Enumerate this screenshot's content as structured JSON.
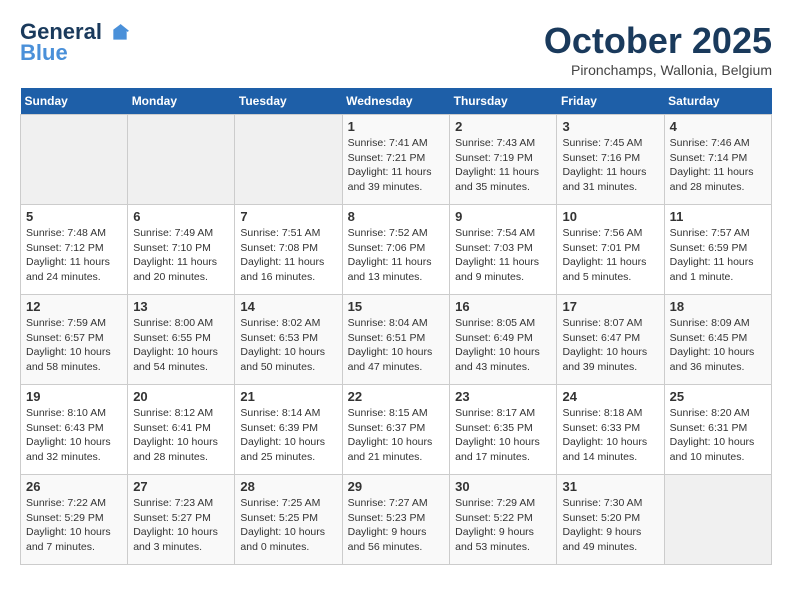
{
  "header": {
    "logo_line1": "General",
    "logo_line2": "Blue",
    "month": "October 2025",
    "location": "Pironchamps, Wallonia, Belgium"
  },
  "weekdays": [
    "Sunday",
    "Monday",
    "Tuesday",
    "Wednesday",
    "Thursday",
    "Friday",
    "Saturday"
  ],
  "weeks": [
    [
      {
        "day": "",
        "info": ""
      },
      {
        "day": "",
        "info": ""
      },
      {
        "day": "",
        "info": ""
      },
      {
        "day": "1",
        "info": "Sunrise: 7:41 AM\nSunset: 7:21 PM\nDaylight: 11 hours and 39 minutes."
      },
      {
        "day": "2",
        "info": "Sunrise: 7:43 AM\nSunset: 7:19 PM\nDaylight: 11 hours and 35 minutes."
      },
      {
        "day": "3",
        "info": "Sunrise: 7:45 AM\nSunset: 7:16 PM\nDaylight: 11 hours and 31 minutes."
      },
      {
        "day": "4",
        "info": "Sunrise: 7:46 AM\nSunset: 7:14 PM\nDaylight: 11 hours and 28 minutes."
      }
    ],
    [
      {
        "day": "5",
        "info": "Sunrise: 7:48 AM\nSunset: 7:12 PM\nDaylight: 11 hours and 24 minutes."
      },
      {
        "day": "6",
        "info": "Sunrise: 7:49 AM\nSunset: 7:10 PM\nDaylight: 11 hours and 20 minutes."
      },
      {
        "day": "7",
        "info": "Sunrise: 7:51 AM\nSunset: 7:08 PM\nDaylight: 11 hours and 16 minutes."
      },
      {
        "day": "8",
        "info": "Sunrise: 7:52 AM\nSunset: 7:06 PM\nDaylight: 11 hours and 13 minutes."
      },
      {
        "day": "9",
        "info": "Sunrise: 7:54 AM\nSunset: 7:03 PM\nDaylight: 11 hours and 9 minutes."
      },
      {
        "day": "10",
        "info": "Sunrise: 7:56 AM\nSunset: 7:01 PM\nDaylight: 11 hours and 5 minutes."
      },
      {
        "day": "11",
        "info": "Sunrise: 7:57 AM\nSunset: 6:59 PM\nDaylight: 11 hours and 1 minute."
      }
    ],
    [
      {
        "day": "12",
        "info": "Sunrise: 7:59 AM\nSunset: 6:57 PM\nDaylight: 10 hours and 58 minutes."
      },
      {
        "day": "13",
        "info": "Sunrise: 8:00 AM\nSunset: 6:55 PM\nDaylight: 10 hours and 54 minutes."
      },
      {
        "day": "14",
        "info": "Sunrise: 8:02 AM\nSunset: 6:53 PM\nDaylight: 10 hours and 50 minutes."
      },
      {
        "day": "15",
        "info": "Sunrise: 8:04 AM\nSunset: 6:51 PM\nDaylight: 10 hours and 47 minutes."
      },
      {
        "day": "16",
        "info": "Sunrise: 8:05 AM\nSunset: 6:49 PM\nDaylight: 10 hours and 43 minutes."
      },
      {
        "day": "17",
        "info": "Sunrise: 8:07 AM\nSunset: 6:47 PM\nDaylight: 10 hours and 39 minutes."
      },
      {
        "day": "18",
        "info": "Sunrise: 8:09 AM\nSunset: 6:45 PM\nDaylight: 10 hours and 36 minutes."
      }
    ],
    [
      {
        "day": "19",
        "info": "Sunrise: 8:10 AM\nSunset: 6:43 PM\nDaylight: 10 hours and 32 minutes."
      },
      {
        "day": "20",
        "info": "Sunrise: 8:12 AM\nSunset: 6:41 PM\nDaylight: 10 hours and 28 minutes."
      },
      {
        "day": "21",
        "info": "Sunrise: 8:14 AM\nSunset: 6:39 PM\nDaylight: 10 hours and 25 minutes."
      },
      {
        "day": "22",
        "info": "Sunrise: 8:15 AM\nSunset: 6:37 PM\nDaylight: 10 hours and 21 minutes."
      },
      {
        "day": "23",
        "info": "Sunrise: 8:17 AM\nSunset: 6:35 PM\nDaylight: 10 hours and 17 minutes."
      },
      {
        "day": "24",
        "info": "Sunrise: 8:18 AM\nSunset: 6:33 PM\nDaylight: 10 hours and 14 minutes."
      },
      {
        "day": "25",
        "info": "Sunrise: 8:20 AM\nSunset: 6:31 PM\nDaylight: 10 hours and 10 minutes."
      }
    ],
    [
      {
        "day": "26",
        "info": "Sunrise: 7:22 AM\nSunset: 5:29 PM\nDaylight: 10 hours and 7 minutes."
      },
      {
        "day": "27",
        "info": "Sunrise: 7:23 AM\nSunset: 5:27 PM\nDaylight: 10 hours and 3 minutes."
      },
      {
        "day": "28",
        "info": "Sunrise: 7:25 AM\nSunset: 5:25 PM\nDaylight: 10 hours and 0 minutes."
      },
      {
        "day": "29",
        "info": "Sunrise: 7:27 AM\nSunset: 5:23 PM\nDaylight: 9 hours and 56 minutes."
      },
      {
        "day": "30",
        "info": "Sunrise: 7:29 AM\nSunset: 5:22 PM\nDaylight: 9 hours and 53 minutes."
      },
      {
        "day": "31",
        "info": "Sunrise: 7:30 AM\nSunset: 5:20 PM\nDaylight: 9 hours and 49 minutes."
      },
      {
        "day": "",
        "info": ""
      }
    ]
  ]
}
